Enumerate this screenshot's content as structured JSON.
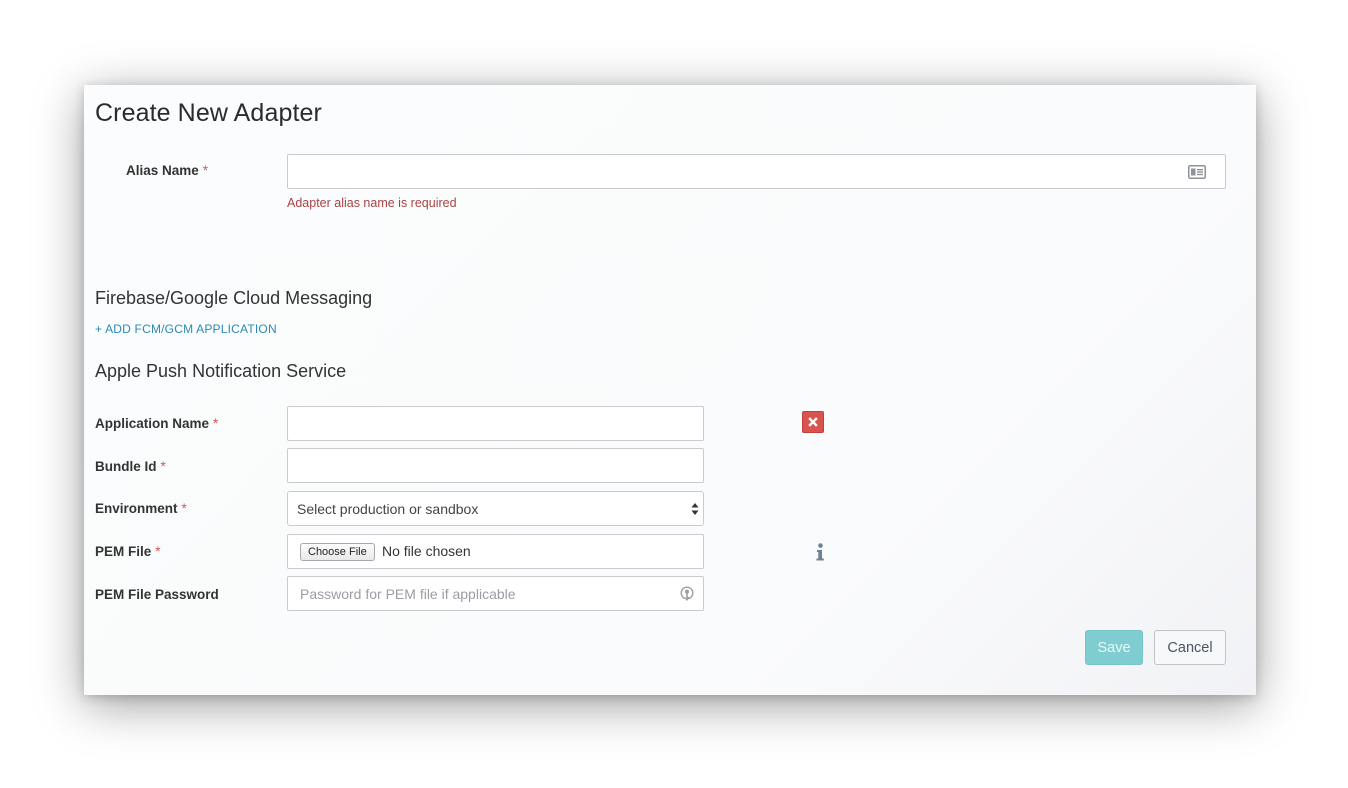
{
  "dialog": {
    "title": "Create New Adapter"
  },
  "alias": {
    "label": "Alias Name",
    "required_mark": "*",
    "value": "",
    "error": "Adapter alias name is required",
    "icon": "contact-card-icon"
  },
  "fcm": {
    "heading": "Firebase/Google Cloud Messaging",
    "add_link": "+ ADD FCM/GCM APPLICATION"
  },
  "apns": {
    "heading": "Apple Push Notification Service",
    "app_name": {
      "label": "Application Name",
      "required_mark": "*",
      "value": ""
    },
    "bundle_id": {
      "label": "Bundle Id",
      "required_mark": "*",
      "value": ""
    },
    "environment": {
      "label": "Environment",
      "required_mark": "*",
      "selected": "Select production or sandbox"
    },
    "pem_file": {
      "label": "PEM File",
      "required_mark": "*",
      "button": "Choose File",
      "status": "No file chosen"
    },
    "pem_password": {
      "label": "PEM File Password",
      "placeholder": "Password for PEM file if applicable",
      "icon": "key-icon"
    },
    "remove_icon": "close-icon",
    "info_icon": "info-icon"
  },
  "actions": {
    "save": "Save",
    "cancel": "Cancel"
  },
  "colors": {
    "required": "#d9534f",
    "error": "#a94442",
    "link": "#2a8bb6",
    "save_button": "#7fcdd0",
    "remove_button": "#d9534f"
  }
}
